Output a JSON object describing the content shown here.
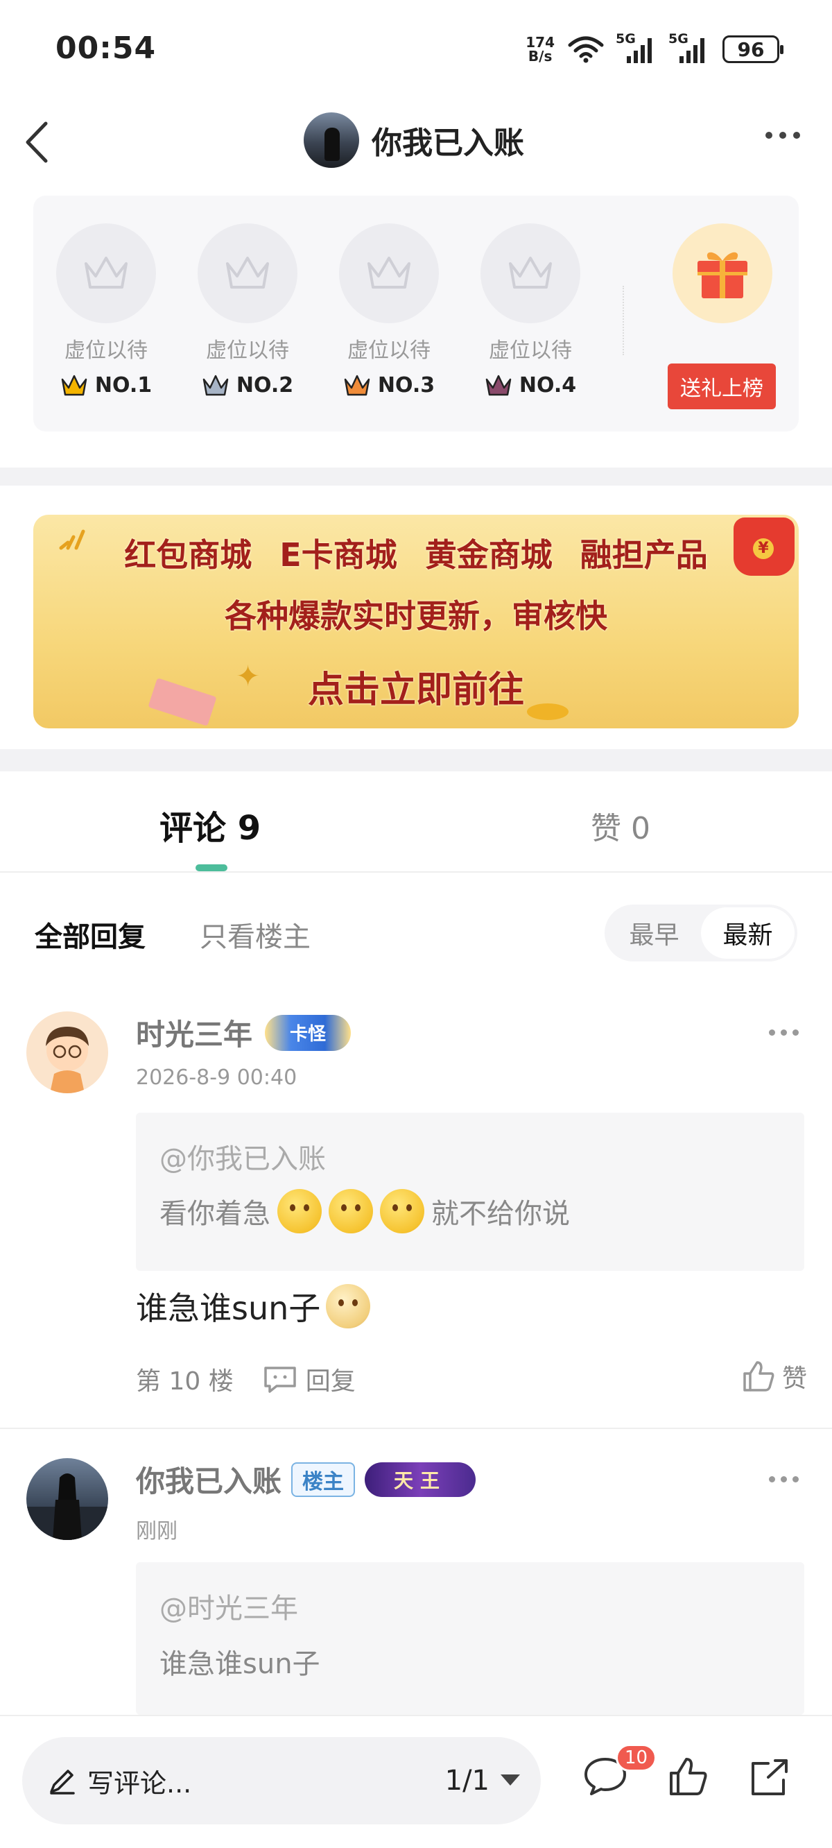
{
  "status_bar": {
    "time": "00:54",
    "net_speed_value": "174",
    "net_speed_unit": "B/s",
    "sim1_tag": "5G",
    "sim2_tag": "5G",
    "battery": "96"
  },
  "nav": {
    "title": "你我已入账"
  },
  "ranking": {
    "slots": [
      {
        "label": "虚位以待",
        "rank": "NO.1",
        "crown_color": "#f4b400"
      },
      {
        "label": "虚位以待",
        "rank": "NO.2",
        "crown_color": "#a7b4c6"
      },
      {
        "label": "虚位以待",
        "rank": "NO.3",
        "crown_color": "#f08c3a"
      },
      {
        "label": "虚位以待",
        "rank": "NO.4",
        "crown_color": "#8a4a6b"
      }
    ],
    "gift_button": "送礼上榜"
  },
  "banner": {
    "line1": [
      "红包商城",
      "E卡商城",
      "黄金商城",
      "融担产品"
    ],
    "line2": "各种爆款实时更新，审核快",
    "line3": "点击立即前往"
  },
  "tabs": {
    "comments": "评论 9",
    "likes": "赞 0"
  },
  "filter": {
    "all": "全部回复",
    "owner_only": "只看楼主",
    "sort_earliest": "最早",
    "sort_latest": "最新"
  },
  "comments": [
    {
      "name": "时光三年",
      "badge": "卡怪",
      "time": "2026-8-9 00:40",
      "quote_at": "@你我已入账",
      "quote_text_before": "看你着急",
      "quote_text_after": "就不给你说",
      "body": "谁急谁sun子",
      "floor": "第 10 楼",
      "reply": "回复",
      "like": "赞"
    },
    {
      "name": "你我已入账",
      "owner_badge": "楼主",
      "level_badge": "天王",
      "time": "刚刚",
      "quote_at": "@时光三年",
      "quote_text": "谁急谁sun子"
    }
  ],
  "bottom_bar": {
    "write_placeholder": "写评论...",
    "page_indicator": "1/1",
    "comment_count_badge": "10"
  },
  "colors": {
    "accent_green": "#4dbd9b",
    "gift_red": "#e8473a",
    "badge_red": "#f05a4f"
  }
}
